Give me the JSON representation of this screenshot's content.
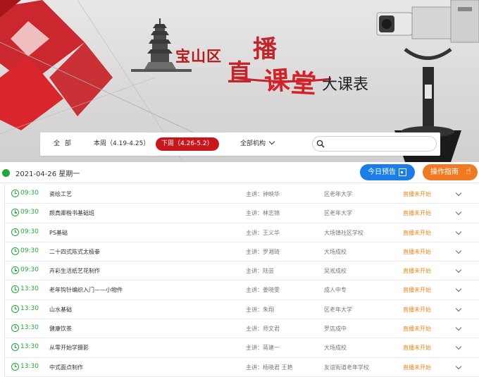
{
  "banner": {
    "district": "宝山区",
    "title_chars": [
      "直",
      "播",
      "课",
      "堂"
    ],
    "subtitle": "大课表"
  },
  "filters": {
    "all": "全 部",
    "this_week": "本周（4.19-4.25）",
    "next_week": "下周（4.26-5.2）",
    "org": "全部机构",
    "search_placeholder": ""
  },
  "date_header": {
    "date": "2021-04-26 星期一",
    "today_button": "今日预告",
    "guide_button": "操作指南"
  },
  "colors": {
    "accent_red": "#c8161d",
    "green": "#22a63c",
    "blue": "#1a7ee6",
    "orange": "#f07a22",
    "status": "#e48a1c"
  },
  "courses": [
    {
      "time": "09:30",
      "title": "瓷绘工艺",
      "teacher": "主讲：钟映华",
      "org": "区老年大学",
      "status": "直播未开始"
    },
    {
      "time": "09:30",
      "title": "颜真卿楷书基础班",
      "teacher": "主讲：林志锦",
      "org": "区老年大学",
      "status": "直播未开始"
    },
    {
      "time": "09:30",
      "title": "PS基础",
      "teacher": "主讲：王义华",
      "org": "大场镇社区学校",
      "status": "直播未开始"
    },
    {
      "time": "09:30",
      "title": "二十四式陈式太极拳",
      "teacher": "主讲：罗湘琦",
      "org": "大场成校",
      "status": "直播未开始"
    },
    {
      "time": "09:30",
      "title": "卉彩生活纸艺花制作",
      "teacher": "主讲：陆芸",
      "org": "吴淞成校",
      "status": "直播未开始"
    },
    {
      "time": "13:30",
      "title": "老年钩针编织入门——小物件",
      "teacher": "主讲：姜晓雯",
      "org": "成人中专",
      "status": "直播未开始"
    },
    {
      "time": "13:30",
      "title": "山水基础",
      "teacher": "主讲：朱翔",
      "org": "区老年大学",
      "status": "直播未开始"
    },
    {
      "time": "13:30",
      "title": "健康饮茶",
      "teacher": "主讲：师文君",
      "org": "罗店成中",
      "status": "直播未开始"
    },
    {
      "time": "13:30",
      "title": "从零开始学摄影",
      "teacher": "主讲：蒋建一",
      "org": "大场成校",
      "status": "直播未开始"
    },
    {
      "time": "13:30",
      "title": "中式面点制作",
      "teacher": "主讲：杨晓君 王艳",
      "org": "友谊街道老年学校",
      "status": "直播未开始"
    }
  ]
}
